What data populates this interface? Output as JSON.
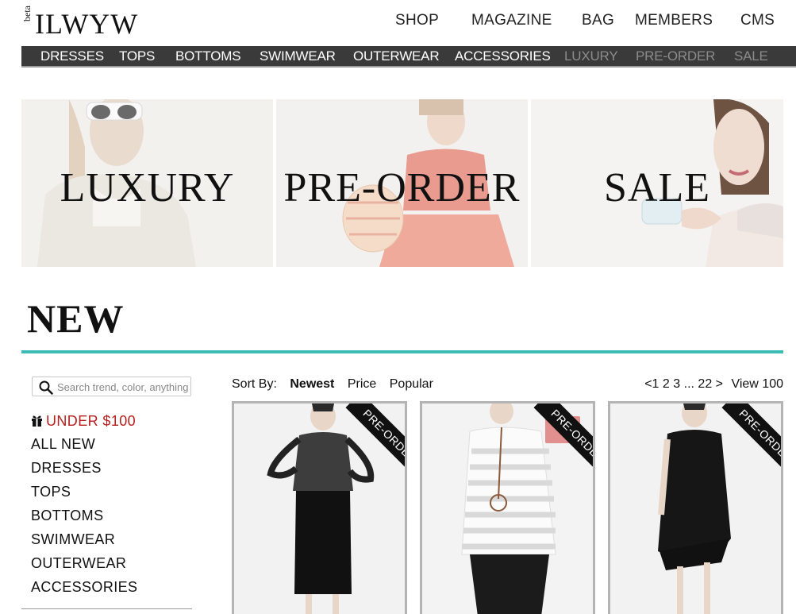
{
  "header": {
    "logo_beta": "beta",
    "logo_text": "ILWYW",
    "nav": [
      "SHOP",
      "MAGAZINE",
      "BAG",
      "MEMBERS",
      "CMS"
    ]
  },
  "categories": [
    {
      "label": "DRESSES",
      "muted": false
    },
    {
      "label": "TOPS",
      "muted": false
    },
    {
      "label": "BOTTOMS",
      "muted": false
    },
    {
      "label": "SWIMWEAR",
      "muted": false
    },
    {
      "label": "OUTERWEAR",
      "muted": false
    },
    {
      "label": "ACCESSORIES",
      "muted": false
    },
    {
      "label": "LUXURY",
      "muted": true
    },
    {
      "label": "PRE-ORDER",
      "muted": true
    },
    {
      "label": "SALE",
      "muted": true
    }
  ],
  "banners": [
    "LUXURY",
    "PRE-ORDER",
    "SALE"
  ],
  "section_title": "NEW",
  "search": {
    "placeholder": "Search trend, color, anything"
  },
  "sidebar": {
    "highlight": "UNDER $100",
    "items": [
      "ALL NEW",
      "DRESSES",
      "TOPS",
      "BOTTOMS",
      "SWIMWEAR",
      "OUTERWEAR",
      "ACCESSORIES"
    ]
  },
  "sort": {
    "label": "Sort By:",
    "options": [
      "Newest",
      "Price",
      "Popular"
    ],
    "active": "Newest"
  },
  "pagination": {
    "prev": "<",
    "pages": [
      "1",
      "2",
      "3",
      "...",
      "22"
    ],
    "next": ">",
    "view_all": "View 100"
  },
  "products": [
    {
      "badge": "PRE-ORDER"
    },
    {
      "badge": "PRE-ORDER"
    },
    {
      "badge": "PRE-ORDER"
    }
  ],
  "colors": {
    "accent": "#3cbcb4",
    "highlight": "#b6201f",
    "catbar": "#3a3a3a"
  }
}
